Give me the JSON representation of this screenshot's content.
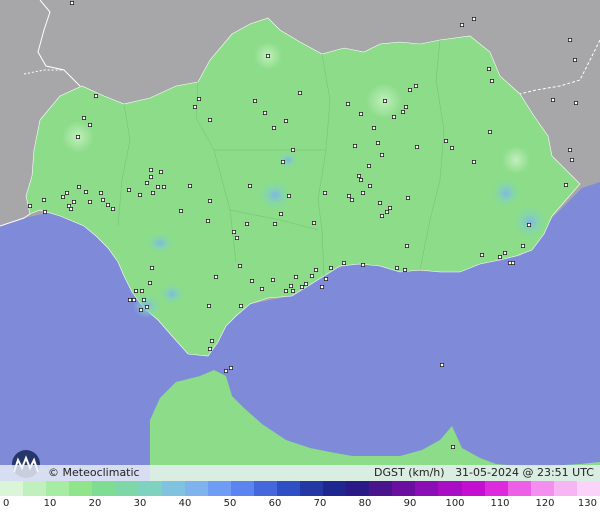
{
  "credit": "© Meteoclimatic",
  "variable": "DGST (km/h)",
  "timestamp": "31-05-2024 @ 23:51 UTC",
  "legend": {
    "ticks": [
      "0",
      "10",
      "20",
      "30",
      "40",
      "50",
      "60",
      "70",
      "80",
      "90",
      "100",
      "110",
      "120",
      "130"
    ],
    "colors": [
      "#dbf5d8",
      "#c0f0bd",
      "#a6eca3",
      "#8fe48c",
      "#7fdc93",
      "#7fd7a7",
      "#7fd2c0",
      "#7fc3de",
      "#7fb3ee",
      "#6f9df5",
      "#5b84f0",
      "#4467dc",
      "#2f4fc4",
      "#2338a4",
      "#1f2690",
      "#2a1a88",
      "#4a148c",
      "#6a0fa0",
      "#8a0fb4",
      "#a80fc4",
      "#c40fd0",
      "#dd2adc",
      "#ec5fe6",
      "#f48fef",
      "#f8b5f4",
      "#fbd2f8"
    ]
  },
  "icons": {
    "logo": "meteoclimatic-logo-icon",
    "station": "station-marker-icon"
  },
  "colors": {
    "sea": "#7f8bd9",
    "land": "#8cdc8a",
    "foreign_land": "#a7a7a9",
    "border": "#ffffff"
  },
  "stations": [
    [
      72,
      3
    ],
    [
      268,
      56
    ],
    [
      255,
      101
    ],
    [
      300,
      93
    ],
    [
      265,
      113
    ],
    [
      274,
      128
    ],
    [
      286,
      121
    ],
    [
      210,
      120
    ],
    [
      199,
      99
    ],
    [
      195,
      107
    ],
    [
      348,
      104
    ],
    [
      385,
      101
    ],
    [
      410,
      90
    ],
    [
      416,
      86
    ],
    [
      406,
      107
    ],
    [
      403,
      112
    ],
    [
      394,
      117
    ],
    [
      361,
      114
    ],
    [
      374,
      128
    ],
    [
      378,
      143
    ],
    [
      355,
      146
    ],
    [
      382,
      155
    ],
    [
      369,
      166
    ],
    [
      359,
      176
    ],
    [
      361,
      180
    ],
    [
      363,
      193
    ],
    [
      370,
      186
    ],
    [
      352,
      200
    ],
    [
      417,
      147
    ],
    [
      452,
      148
    ],
    [
      474,
      162
    ],
    [
      490,
      132
    ],
    [
      492,
      81
    ],
    [
      489,
      69
    ],
    [
      462,
      25
    ],
    [
      474,
      19
    ],
    [
      570,
      40
    ],
    [
      575,
      60
    ],
    [
      553,
      100
    ],
    [
      576,
      103
    ],
    [
      570,
      150
    ],
    [
      572,
      160
    ],
    [
      566,
      185
    ],
    [
      529,
      225
    ],
    [
      523,
      246
    ],
    [
      505,
      253
    ],
    [
      500,
      257
    ],
    [
      482,
      255
    ],
    [
      510,
      263
    ],
    [
      513,
      263
    ],
    [
      407,
      246
    ],
    [
      397,
      268
    ],
    [
      405,
      270
    ],
    [
      363,
      265
    ],
    [
      344,
      263
    ],
    [
      331,
      268
    ],
    [
      326,
      279
    ],
    [
      322,
      287
    ],
    [
      316,
      270
    ],
    [
      312,
      276
    ],
    [
      306,
      284
    ],
    [
      296,
      277
    ],
    [
      291,
      286
    ],
    [
      293,
      291
    ],
    [
      286,
      291
    ],
    [
      302,
      287
    ],
    [
      273,
      280
    ],
    [
      262,
      289
    ],
    [
      241,
      306
    ],
    [
      252,
      281
    ],
    [
      240,
      266
    ],
    [
      216,
      277
    ],
    [
      209,
      306
    ],
    [
      212,
      341
    ],
    [
      210,
      349
    ],
    [
      226,
      371
    ],
    [
      231,
      368
    ],
    [
      152,
      268
    ],
    [
      150,
      283
    ],
    [
      142,
      291
    ],
    [
      144,
      300
    ],
    [
      136,
      291
    ],
    [
      134,
      300
    ],
    [
      147,
      307
    ],
    [
      130,
      300
    ],
    [
      141,
      310
    ],
    [
      78,
      137
    ],
    [
      84,
      118
    ],
    [
      90,
      125
    ],
    [
      96,
      96
    ],
    [
      30,
      206
    ],
    [
      44,
      200
    ],
    [
      45,
      212
    ],
    [
      63,
      197
    ],
    [
      67,
      193
    ],
    [
      69,
      206
    ],
    [
      71,
      209
    ],
    [
      74,
      202
    ],
    [
      79,
      187
    ],
    [
      86,
      192
    ],
    [
      90,
      202
    ],
    [
      101,
      193
    ],
    [
      103,
      200
    ],
    [
      108,
      205
    ],
    [
      113,
      209
    ],
    [
      129,
      190
    ],
    [
      140,
      195
    ],
    [
      147,
      183
    ],
    [
      151,
      177
    ],
    [
      153,
      193
    ],
    [
      158,
      187
    ],
    [
      161,
      172
    ],
    [
      164,
      187
    ],
    [
      151,
      170
    ],
    [
      190,
      186
    ],
    [
      181,
      211
    ],
    [
      210,
      201
    ],
    [
      208,
      221
    ],
    [
      283,
      162
    ],
    [
      293,
      150
    ],
    [
      289,
      196
    ],
    [
      250,
      186
    ],
    [
      281,
      214
    ],
    [
      314,
      223
    ],
    [
      275,
      224
    ],
    [
      247,
      224
    ],
    [
      234,
      232
    ],
    [
      237,
      238
    ],
    [
      325,
      193
    ],
    [
      349,
      196
    ],
    [
      380,
      203
    ],
    [
      387,
      212
    ],
    [
      390,
      208
    ],
    [
      382,
      216
    ],
    [
      408,
      198
    ],
    [
      446,
      141
    ],
    [
      453,
      447
    ],
    [
      442,
      365
    ]
  ]
}
